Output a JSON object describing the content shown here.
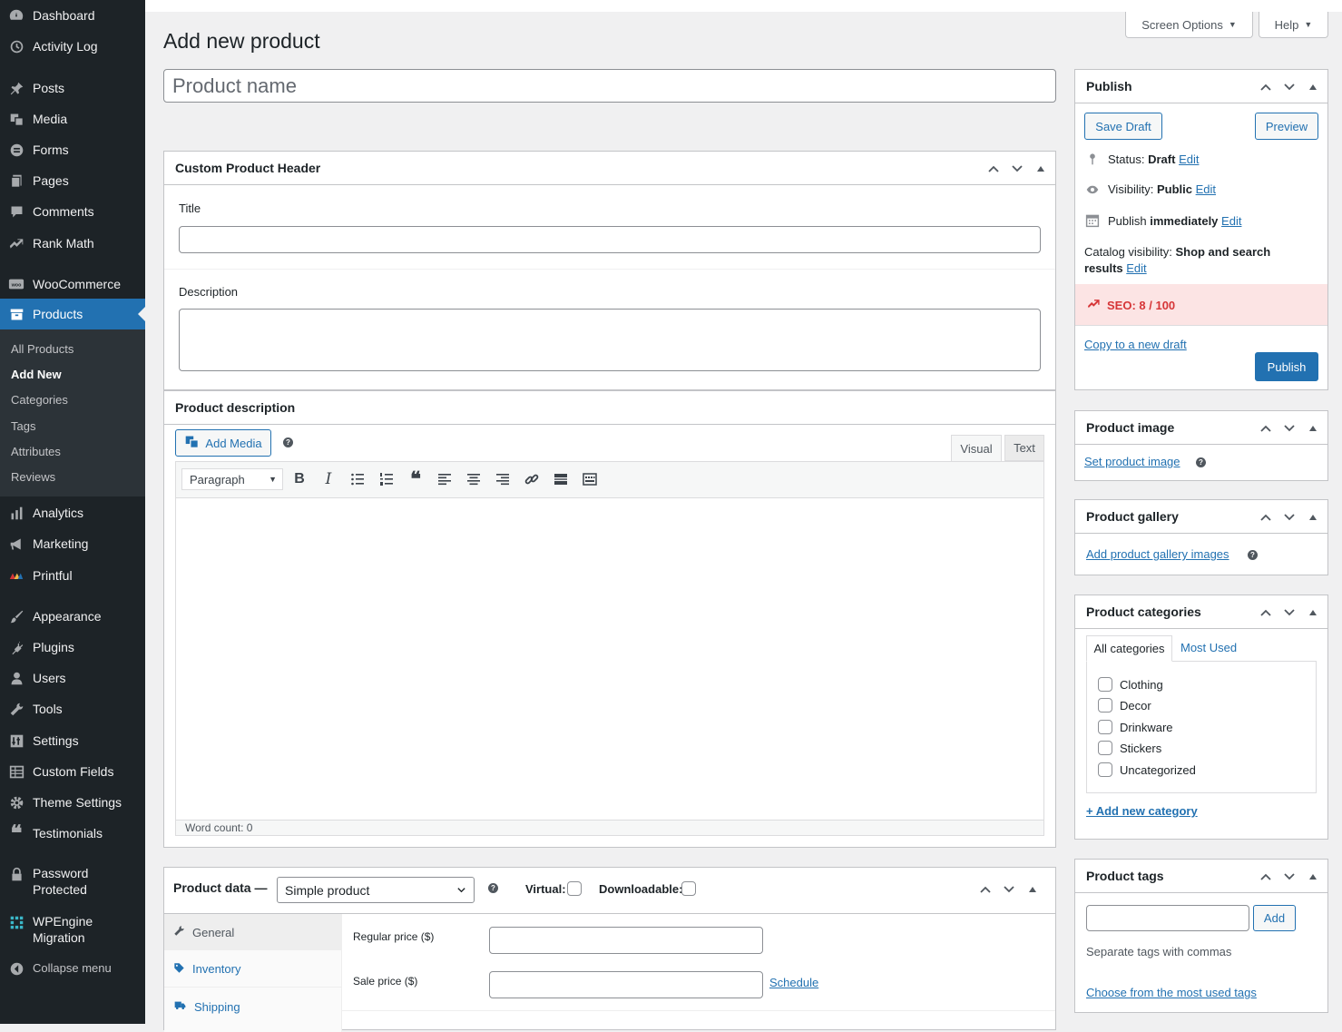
{
  "sidebar": {
    "items": [
      {
        "label": "Dashboard",
        "icon": "dashboard-icon"
      },
      {
        "label": "Activity Log",
        "icon": "history-icon"
      },
      {
        "label": "Posts",
        "icon": "pushpin-icon"
      },
      {
        "label": "Media",
        "icon": "media-icon"
      },
      {
        "label": "Forms",
        "icon": "forms-icon"
      },
      {
        "label": "Pages",
        "icon": "pages-icon"
      },
      {
        "label": "Comments",
        "icon": "comment-icon"
      },
      {
        "label": "Rank Math",
        "icon": "rank-math-icon"
      },
      {
        "label": "WooCommerce",
        "icon": "woocommerce-icon"
      },
      {
        "label": "Products",
        "icon": "products-icon"
      },
      {
        "label": "Analytics",
        "icon": "bar-chart-icon"
      },
      {
        "label": "Marketing",
        "icon": "megaphone-icon"
      },
      {
        "label": "Printful",
        "icon": "printful-icon"
      },
      {
        "label": "Appearance",
        "icon": "brush-icon"
      },
      {
        "label": "Plugins",
        "icon": "plug-icon"
      },
      {
        "label": "Users",
        "icon": "user-icon"
      },
      {
        "label": "Tools",
        "icon": "wrench-icon"
      },
      {
        "label": "Settings",
        "icon": "settings-icon"
      },
      {
        "label": "Custom Fields",
        "icon": "table-icon"
      },
      {
        "label": "Theme Settings",
        "icon": "gear-icon"
      },
      {
        "label": "Testimonials",
        "icon": "quote-icon"
      },
      {
        "label": "Password Protected",
        "icon": "lock-icon"
      },
      {
        "label": "WPEngine Migration",
        "icon": "grid-icon"
      },
      {
        "label": "Collapse menu",
        "icon": "collapse-icon"
      }
    ],
    "submenu": [
      "All Products",
      "Add New",
      "Categories",
      "Tags",
      "Attributes",
      "Reviews"
    ]
  },
  "topbar": {
    "screen_options": "Screen Options",
    "help": "Help"
  },
  "page": {
    "title": "Add new product",
    "product_name_placeholder": "Product name"
  },
  "custom_header": {
    "title": "Custom Product Header",
    "title_label": "Title",
    "description_label": "Description"
  },
  "product_description": {
    "title": "Product description",
    "add_media": "Add Media",
    "tab_visual": "Visual",
    "tab_text": "Text",
    "format_select": "Paragraph",
    "word_count": "Word count: 0"
  },
  "product_data": {
    "title": "Product data —",
    "type_select": "Simple product",
    "virtual_label": "Virtual:",
    "downloadable_label": "Downloadable:",
    "tabs": [
      "General",
      "Inventory",
      "Shipping"
    ],
    "regular_price_label": "Regular price ($)",
    "sale_price_label": "Sale price ($)",
    "schedule_link": "Schedule"
  },
  "publish": {
    "title": "Publish",
    "save_draft": "Save Draft",
    "preview": "Preview",
    "status_label": "Status:",
    "status_value": "Draft",
    "visibility_label": "Visibility:",
    "visibility_value": "Public",
    "publish_label": "Publish",
    "publish_value": "immediately",
    "catalog_label": "Catalog visibility:",
    "catalog_value": "Shop and search results",
    "edit": "Edit",
    "seo": "SEO: 8 / 100",
    "copy_draft": "Copy to a new draft",
    "publish_button": "Publish"
  },
  "product_image": {
    "title": "Product image",
    "link": "Set product image"
  },
  "product_gallery": {
    "title": "Product gallery",
    "link": "Add product gallery images"
  },
  "product_categories": {
    "title": "Product categories",
    "tab_all": "All categories",
    "tab_most_used": "Most Used",
    "items": [
      "Clothing",
      "Decor",
      "Drinkware",
      "Stickers",
      "Uncategorized"
    ],
    "add_new": "+ Add new category"
  },
  "product_tags": {
    "title": "Product tags",
    "add_button": "Add",
    "hint": "Separate tags with commas",
    "choose_link": "Choose from the most used tags"
  },
  "colors": {
    "sidebar_bg": "#1d2327",
    "accent": "#2271b1",
    "seo_bg": "#fce4e4",
    "seo_text": "#d63638"
  }
}
